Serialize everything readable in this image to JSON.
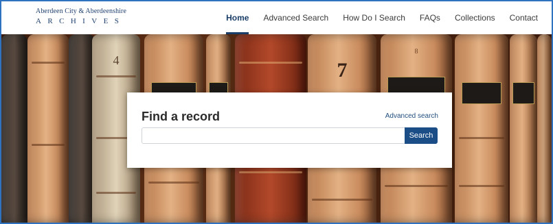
{
  "logo": {
    "line1": "Aberdeen City & Aberdeenshire",
    "line2": "ARCHIVES"
  },
  "nav": {
    "items": [
      {
        "label": "Home",
        "active": true
      },
      {
        "label": "Advanced Search",
        "active": false
      },
      {
        "label": "How Do I Search",
        "active": false
      },
      {
        "label": "FAQs",
        "active": false
      },
      {
        "label": "Collections",
        "active": false
      },
      {
        "label": "Contact",
        "active": false
      }
    ]
  },
  "hero": {
    "book_numbers": [
      "4",
      "7",
      "8"
    ]
  },
  "search_card": {
    "title": "Find a record",
    "advanced_link": "Advanced search",
    "input_value": "",
    "input_placeholder": "",
    "button_label": "Search"
  },
  "colors": {
    "accent": "#1b4d86",
    "frame_border": "#2f73c0",
    "nav_active": "#1b3e68"
  }
}
